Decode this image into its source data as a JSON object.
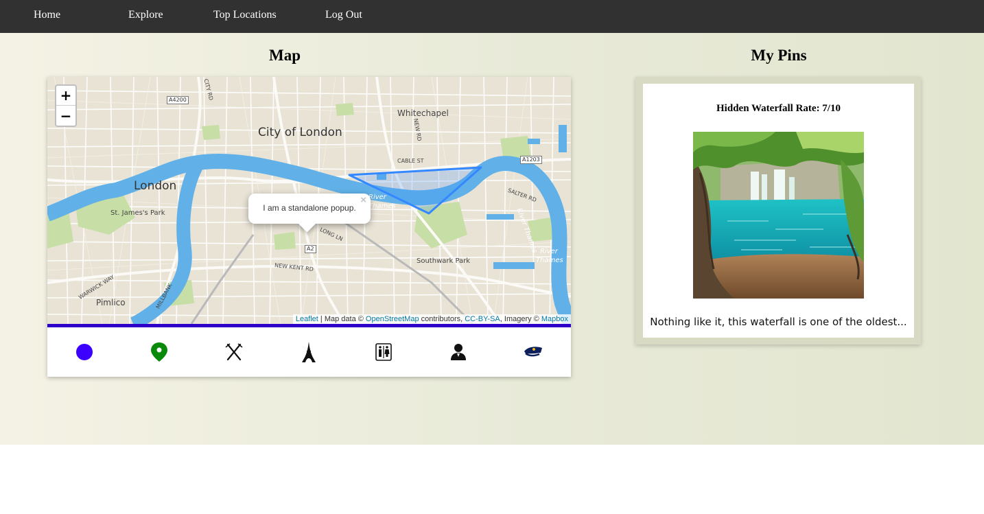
{
  "nav": {
    "items": [
      {
        "label": "Home"
      },
      {
        "label": "Explore"
      },
      {
        "label": "Top Locations"
      },
      {
        "label": "Log Out"
      }
    ]
  },
  "map_section": {
    "title": "Map",
    "zoom_in_label": "+",
    "zoom_out_label": "−",
    "popup": {
      "text": "I am a standalone popup.",
      "close_label": "×"
    },
    "labels": {
      "city_of_london": "City of London",
      "london": "London",
      "whitechapel": "Whitechapel",
      "st_james_park": "St. James's Park",
      "southwark_park": "Southwark Park",
      "pimlico": "Pimlico",
      "river_thames_1": "River",
      "river_thames_1b": "Thames",
      "river_thames_2": "River Thames",
      "river_thames_3": "River",
      "river_thames_3b": "Thames",
      "road_a4200": "A4200",
      "road_a1203": "A1203",
      "road_a2": "A2",
      "cable_st": "CABLE ST",
      "long_ln": "LONG LN",
      "new_kent_rd": "NEW KENT RD",
      "salter_rd": "SALTER RD",
      "warwick_way": "WARWICK WAY",
      "millbank": "MILLBANK",
      "new_rd": "NEW RD",
      "city_rd": "CITY RD"
    },
    "attribution": {
      "leaflet": "Leaflet",
      "sep1": " | Map data © ",
      "osm": "OpenStreetMap",
      "sep2": " contributors, ",
      "license": "CC-BY-SA",
      "sep3": ", Imagery © ",
      "mapbox": "Mapbox"
    },
    "accent_border_color": "#2c00c8",
    "toolbar_icons": [
      {
        "name": "circle-icon",
        "color": "#3b00ff"
      },
      {
        "name": "map-pin-icon",
        "color": "#0a8a0a"
      },
      {
        "name": "fork-knife-icon",
        "color": "#111111"
      },
      {
        "name": "eiffel-tower-icon",
        "color": "#111111"
      },
      {
        "name": "restroom-icon",
        "color": "#111111"
      },
      {
        "name": "person-icon",
        "color": "#111111"
      },
      {
        "name": "police-cap-icon",
        "color": "#0c1f5c"
      }
    ]
  },
  "pins_section": {
    "title": "My Pins",
    "pin": {
      "title": "Hidden Waterfall Rate: 7/10",
      "description": "Nothing like it, this waterfall is one of the oldest..."
    }
  }
}
